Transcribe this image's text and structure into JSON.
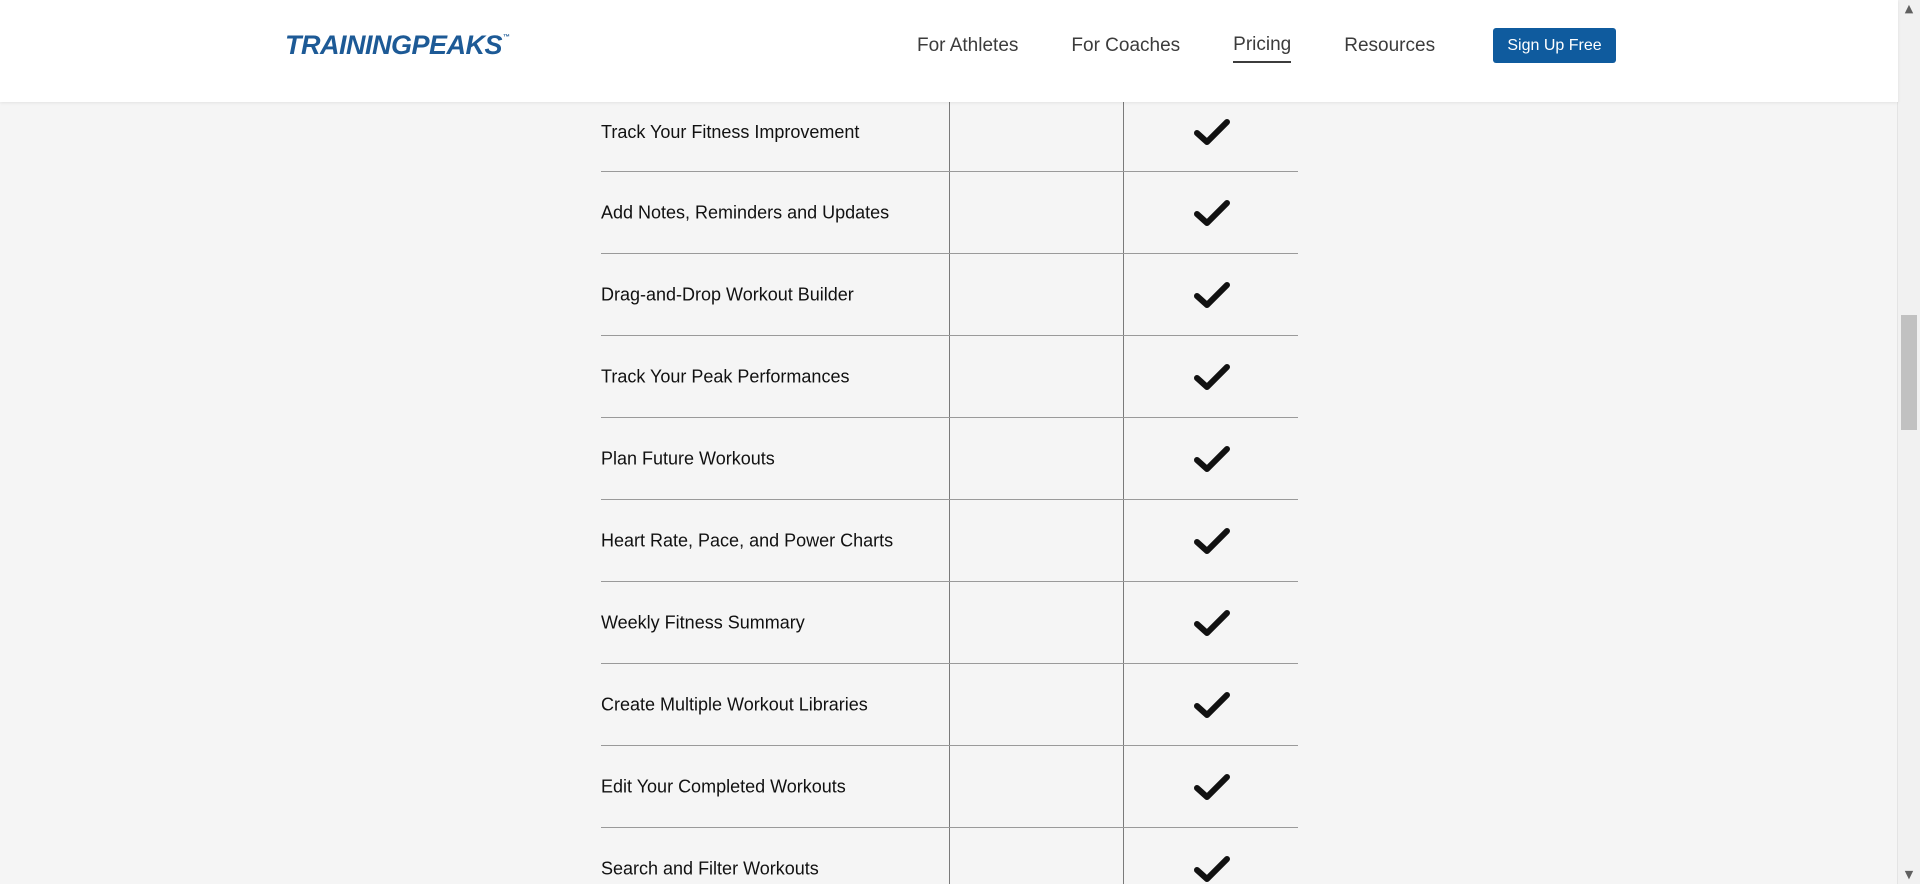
{
  "header": {
    "logo_text": "TRAININGPEAKS",
    "logo_tm": "™",
    "nav": [
      "For Athletes",
      "For Coaches",
      "Pricing",
      "Resources"
    ],
    "active_nav": "Pricing",
    "signup_label": "Sign Up Free",
    "brand_color": "#0f5b9e"
  },
  "features": [
    {
      "name": "Track Your Fitness Improvement",
      "basic": false,
      "premium": true
    },
    {
      "name": "Add Notes, Reminders and Updates",
      "basic": false,
      "premium": true
    },
    {
      "name": "Drag-and-Drop Workout Builder",
      "basic": false,
      "premium": true
    },
    {
      "name": "Track Your Peak Performances",
      "basic": false,
      "premium": true
    },
    {
      "name": "Plan Future Workouts",
      "basic": false,
      "premium": true
    },
    {
      "name": "Heart Rate, Pace, and Power Charts",
      "basic": false,
      "premium": true
    },
    {
      "name": "Weekly Fitness Summary",
      "basic": false,
      "premium": true
    },
    {
      "name": "Create Multiple Workout Libraries",
      "basic": false,
      "premium": true
    },
    {
      "name": "Edit Your Completed Workouts",
      "basic": false,
      "premium": true
    },
    {
      "name": "Search and Filter Workouts",
      "basic": false,
      "premium": true
    }
  ],
  "scrollbar": {
    "up_icon": "chevron-up-icon",
    "down_icon": "chevron-down-icon"
  }
}
